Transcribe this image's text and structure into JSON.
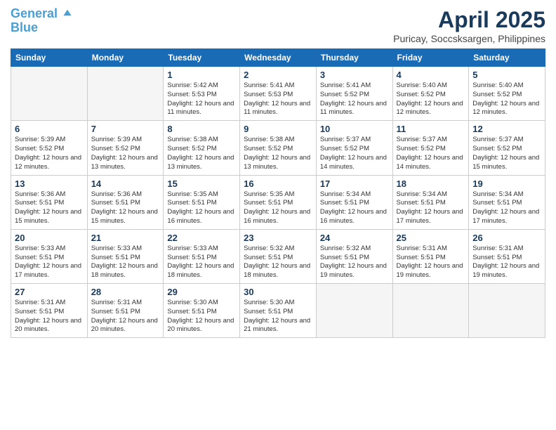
{
  "header": {
    "logo_line1": "General",
    "logo_line2": "Blue",
    "month_title": "April 2025",
    "subtitle": "Puricay, Soccsksargen, Philippines"
  },
  "days_of_week": [
    "Sunday",
    "Monday",
    "Tuesday",
    "Wednesday",
    "Thursday",
    "Friday",
    "Saturday"
  ],
  "weeks": [
    [
      {
        "day": "",
        "info": ""
      },
      {
        "day": "",
        "info": ""
      },
      {
        "day": "1",
        "info": "Sunrise: 5:42 AM\nSunset: 5:53 PM\nDaylight: 12 hours\nand 11 minutes."
      },
      {
        "day": "2",
        "info": "Sunrise: 5:41 AM\nSunset: 5:53 PM\nDaylight: 12 hours\nand 11 minutes."
      },
      {
        "day": "3",
        "info": "Sunrise: 5:41 AM\nSunset: 5:52 PM\nDaylight: 12 hours\nand 11 minutes."
      },
      {
        "day": "4",
        "info": "Sunrise: 5:40 AM\nSunset: 5:52 PM\nDaylight: 12 hours\nand 12 minutes."
      },
      {
        "day": "5",
        "info": "Sunrise: 5:40 AM\nSunset: 5:52 PM\nDaylight: 12 hours\nand 12 minutes."
      }
    ],
    [
      {
        "day": "6",
        "info": "Sunrise: 5:39 AM\nSunset: 5:52 PM\nDaylight: 12 hours\nand 12 minutes."
      },
      {
        "day": "7",
        "info": "Sunrise: 5:39 AM\nSunset: 5:52 PM\nDaylight: 12 hours\nand 13 minutes."
      },
      {
        "day": "8",
        "info": "Sunrise: 5:38 AM\nSunset: 5:52 PM\nDaylight: 12 hours\nand 13 minutes."
      },
      {
        "day": "9",
        "info": "Sunrise: 5:38 AM\nSunset: 5:52 PM\nDaylight: 12 hours\nand 13 minutes."
      },
      {
        "day": "10",
        "info": "Sunrise: 5:37 AM\nSunset: 5:52 PM\nDaylight: 12 hours\nand 14 minutes."
      },
      {
        "day": "11",
        "info": "Sunrise: 5:37 AM\nSunset: 5:52 PM\nDaylight: 12 hours\nand 14 minutes."
      },
      {
        "day": "12",
        "info": "Sunrise: 5:37 AM\nSunset: 5:52 PM\nDaylight: 12 hours\nand 15 minutes."
      }
    ],
    [
      {
        "day": "13",
        "info": "Sunrise: 5:36 AM\nSunset: 5:51 PM\nDaylight: 12 hours\nand 15 minutes."
      },
      {
        "day": "14",
        "info": "Sunrise: 5:36 AM\nSunset: 5:51 PM\nDaylight: 12 hours\nand 15 minutes."
      },
      {
        "day": "15",
        "info": "Sunrise: 5:35 AM\nSunset: 5:51 PM\nDaylight: 12 hours\nand 16 minutes."
      },
      {
        "day": "16",
        "info": "Sunrise: 5:35 AM\nSunset: 5:51 PM\nDaylight: 12 hours\nand 16 minutes."
      },
      {
        "day": "17",
        "info": "Sunrise: 5:34 AM\nSunset: 5:51 PM\nDaylight: 12 hours\nand 16 minutes."
      },
      {
        "day": "18",
        "info": "Sunrise: 5:34 AM\nSunset: 5:51 PM\nDaylight: 12 hours\nand 17 minutes."
      },
      {
        "day": "19",
        "info": "Sunrise: 5:34 AM\nSunset: 5:51 PM\nDaylight: 12 hours\nand 17 minutes."
      }
    ],
    [
      {
        "day": "20",
        "info": "Sunrise: 5:33 AM\nSunset: 5:51 PM\nDaylight: 12 hours\nand 17 minutes."
      },
      {
        "day": "21",
        "info": "Sunrise: 5:33 AM\nSunset: 5:51 PM\nDaylight: 12 hours\nand 18 minutes."
      },
      {
        "day": "22",
        "info": "Sunrise: 5:33 AM\nSunset: 5:51 PM\nDaylight: 12 hours\nand 18 minutes."
      },
      {
        "day": "23",
        "info": "Sunrise: 5:32 AM\nSunset: 5:51 PM\nDaylight: 12 hours\nand 18 minutes."
      },
      {
        "day": "24",
        "info": "Sunrise: 5:32 AM\nSunset: 5:51 PM\nDaylight: 12 hours\nand 19 minutes."
      },
      {
        "day": "25",
        "info": "Sunrise: 5:31 AM\nSunset: 5:51 PM\nDaylight: 12 hours\nand 19 minutes."
      },
      {
        "day": "26",
        "info": "Sunrise: 5:31 AM\nSunset: 5:51 PM\nDaylight: 12 hours\nand 19 minutes."
      }
    ],
    [
      {
        "day": "27",
        "info": "Sunrise: 5:31 AM\nSunset: 5:51 PM\nDaylight: 12 hours\nand 20 minutes."
      },
      {
        "day": "28",
        "info": "Sunrise: 5:31 AM\nSunset: 5:51 PM\nDaylight: 12 hours\nand 20 minutes."
      },
      {
        "day": "29",
        "info": "Sunrise: 5:30 AM\nSunset: 5:51 PM\nDaylight: 12 hours\nand 20 minutes."
      },
      {
        "day": "30",
        "info": "Sunrise: 5:30 AM\nSunset: 5:51 PM\nDaylight: 12 hours\nand 21 minutes."
      },
      {
        "day": "",
        "info": ""
      },
      {
        "day": "",
        "info": ""
      },
      {
        "day": "",
        "info": ""
      }
    ]
  ]
}
